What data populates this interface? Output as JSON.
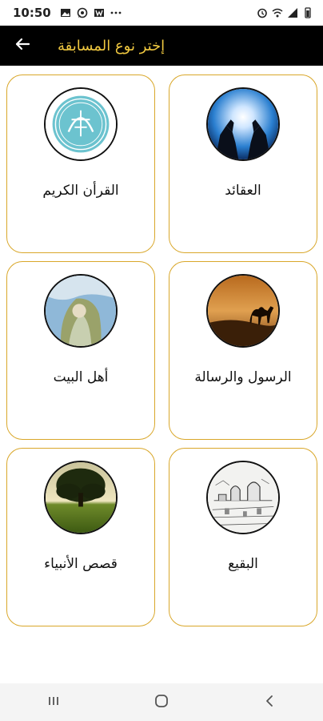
{
  "status_bar": {
    "time": "10:50",
    "left_icons": [
      "image-icon",
      "whatsapp-icon",
      "app-icon",
      "more-dots-icon"
    ],
    "right_icons": [
      "alarm-icon",
      "wifi-icon",
      "signal-icon",
      "battery-icon"
    ]
  },
  "app_bar": {
    "title": "إختر نوع المسابقة",
    "back_icon": "arrow-left-icon"
  },
  "categories": [
    {
      "label": "العقائد",
      "image": "hands-light"
    },
    {
      "label": "القرأن الكريم",
      "image": "quran-emblem"
    },
    {
      "label": "الرسول والرسالة",
      "image": "camel-desert"
    },
    {
      "label": "أهل البيت",
      "image": "painting"
    },
    {
      "label": "البقيع",
      "image": "sketch-shrine"
    },
    {
      "label": "قصص الأنبياء",
      "image": "tree-field"
    }
  ],
  "nav_bar": {
    "recents_icon": "recents-icon",
    "home_icon": "home-icon",
    "back_icon": "back-chevron-icon"
  },
  "colors": {
    "app_bar_bg": "#000000",
    "title": "#f0c840",
    "card_border": "#d9a72a"
  }
}
